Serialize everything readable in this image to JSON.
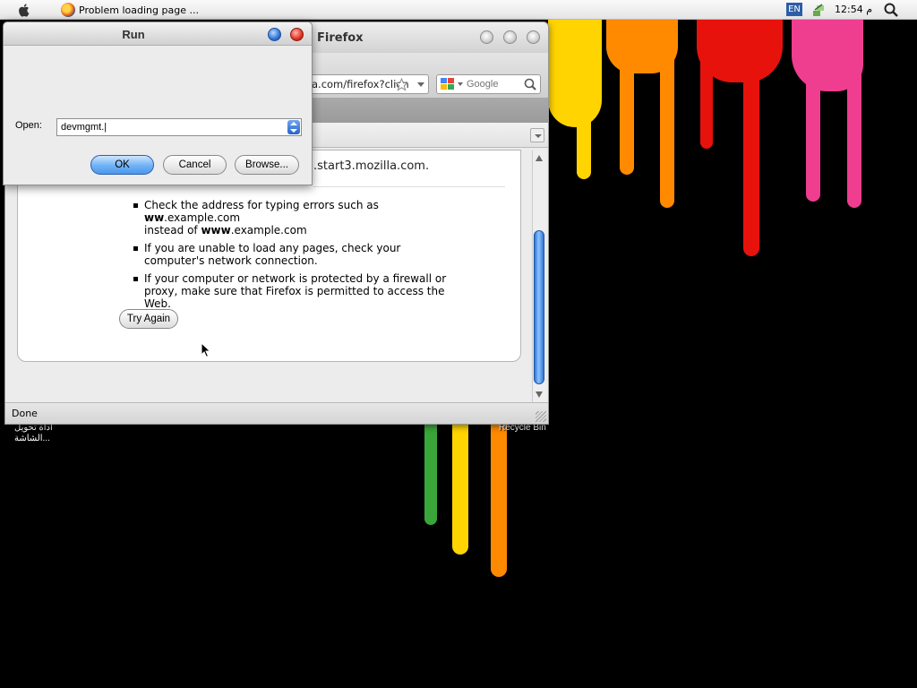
{
  "menubar": {
    "task_title": "Problem loading page ...",
    "language": "EN",
    "clock": "م 12:54"
  },
  "firefox": {
    "title": "Firefox",
    "url": "a.com/firefox?clien",
    "search_placeholder": "Google",
    "error_url": ".start3.mozilla.com.",
    "suggestions": [
      {
        "pre": "Check the address for typing errors such as ",
        "bold1": "ww",
        "mid": ".example.com",
        "line2_pre": "instead of ",
        "bold2": "www",
        "line2_post": ".example.com"
      },
      {
        "text": "If you are unable to load any pages, check your computer's network connection."
      },
      {
        "text": "If your computer or network is protected by a firewall or proxy, make sure that Firefox is permitted to access the Web."
      }
    ],
    "try_again": "Try Again",
    "status": "Done"
  },
  "run_dialog": {
    "title": "Run",
    "open_label": "Open:",
    "open_value": "devmgmt.|",
    "ok": "OK",
    "cancel": "Cancel",
    "browse": "Browse..."
  },
  "desktop": {
    "icon1_line1": "أداة تحويل",
    "icon1_line2": "الشاشة...",
    "recycle_bin": "Recycle Bin"
  },
  "colors": {
    "accent": "#2f76d6",
    "drip_yellow": "#ffd400",
    "drip_orange": "#ff8a00",
    "drip_red": "#e8120c",
    "drip_pink": "#ef3d8f",
    "drip_green": "#3aa63a"
  }
}
